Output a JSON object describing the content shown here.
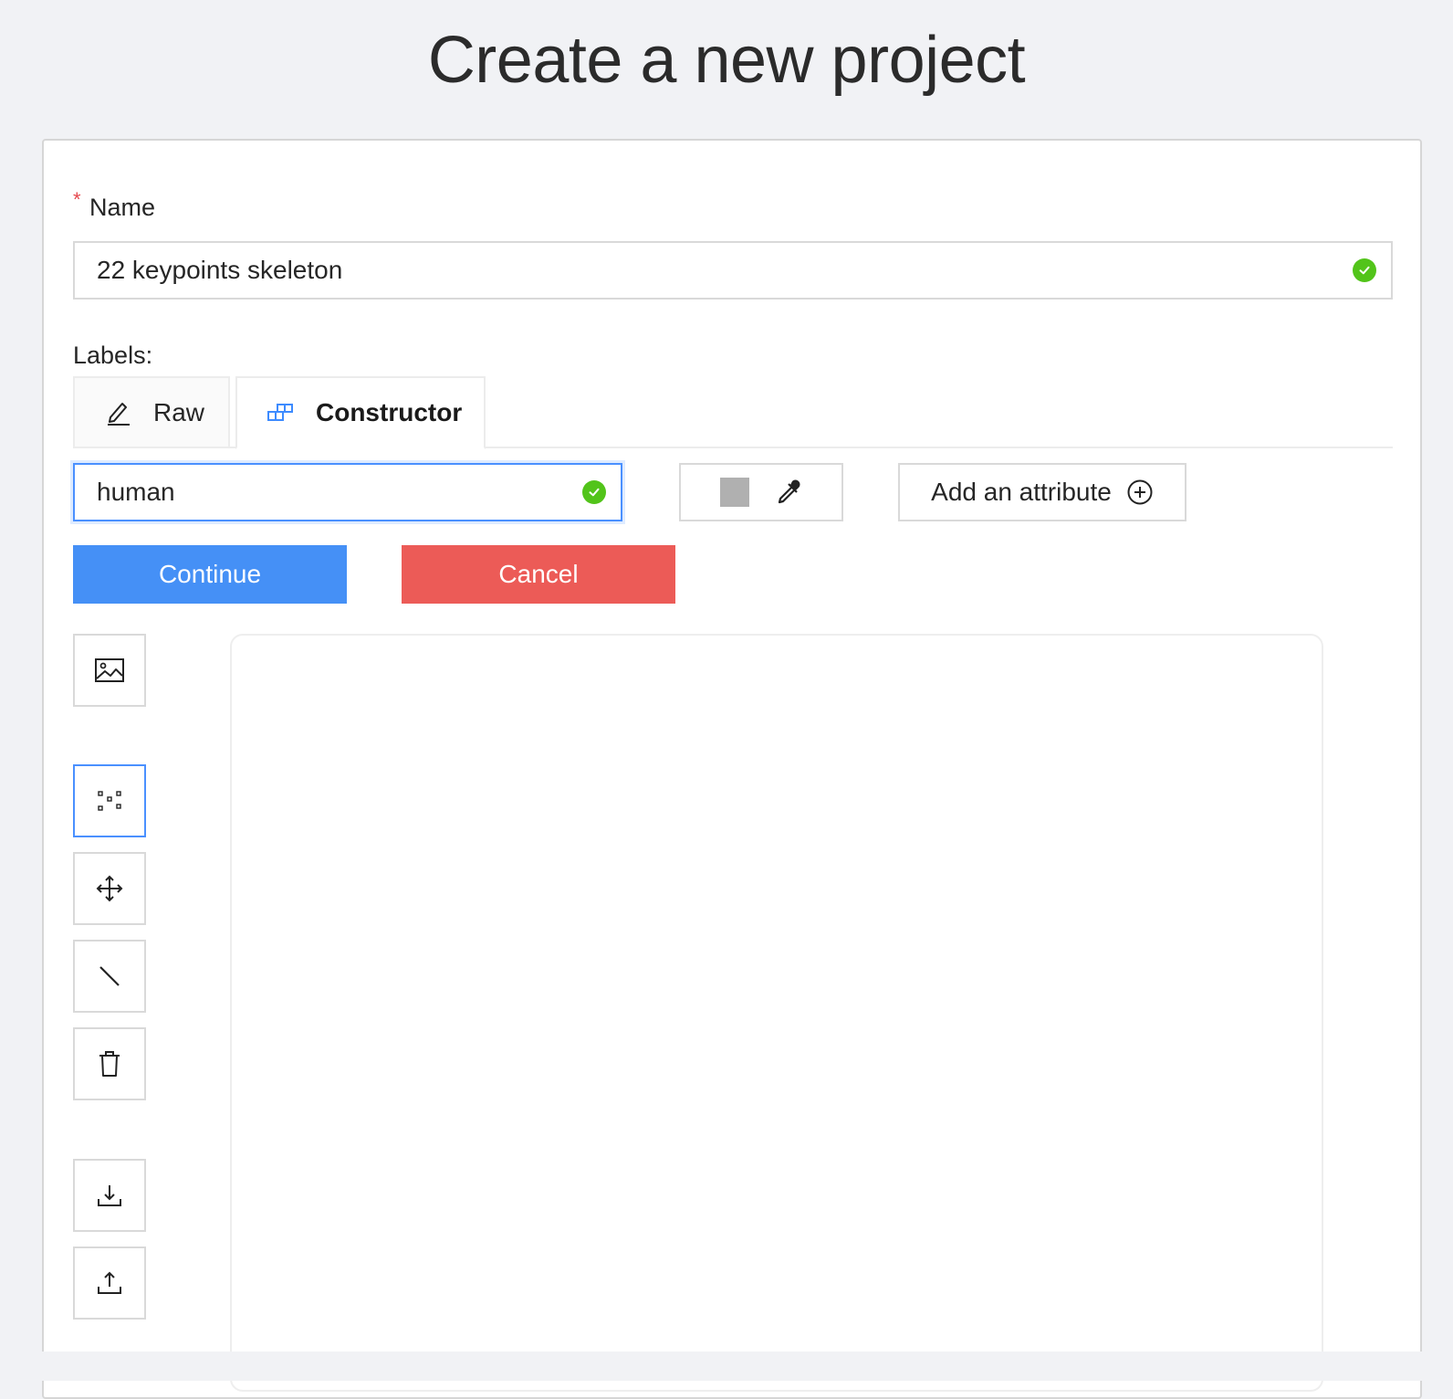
{
  "page": {
    "title": "Create a new project"
  },
  "form": {
    "name_label": "Name",
    "name_required_mark": "*",
    "name_value": "22 keypoints skeleton",
    "labels_heading": "Labels:"
  },
  "tabs": [
    {
      "label": "Raw",
      "icon": "pencil-icon",
      "active": false
    },
    {
      "label": "Constructor",
      "icon": "blocks-icon",
      "active": true
    }
  ],
  "constructor": {
    "label_name_value": "human",
    "color_swatch": "#b0b0b0",
    "add_attribute_label": "Add an attribute",
    "continue_label": "Continue",
    "cancel_label": "Cancel"
  },
  "toolbar": [
    {
      "name": "image",
      "icon": "image-icon"
    },
    {
      "name": "keypoints",
      "icon": "points-icon",
      "active": true
    },
    {
      "name": "move",
      "icon": "move-icon"
    },
    {
      "name": "edge",
      "icon": "line-icon"
    },
    {
      "name": "delete",
      "icon": "trash-icon"
    },
    {
      "name": "download",
      "icon": "download-icon"
    },
    {
      "name": "upload",
      "icon": "upload-icon"
    }
  ],
  "colors": {
    "primary": "#4590f6",
    "danger": "#ec5b57",
    "success": "#52c41a",
    "required": "#e5484d",
    "focus": "#4a90ff"
  }
}
